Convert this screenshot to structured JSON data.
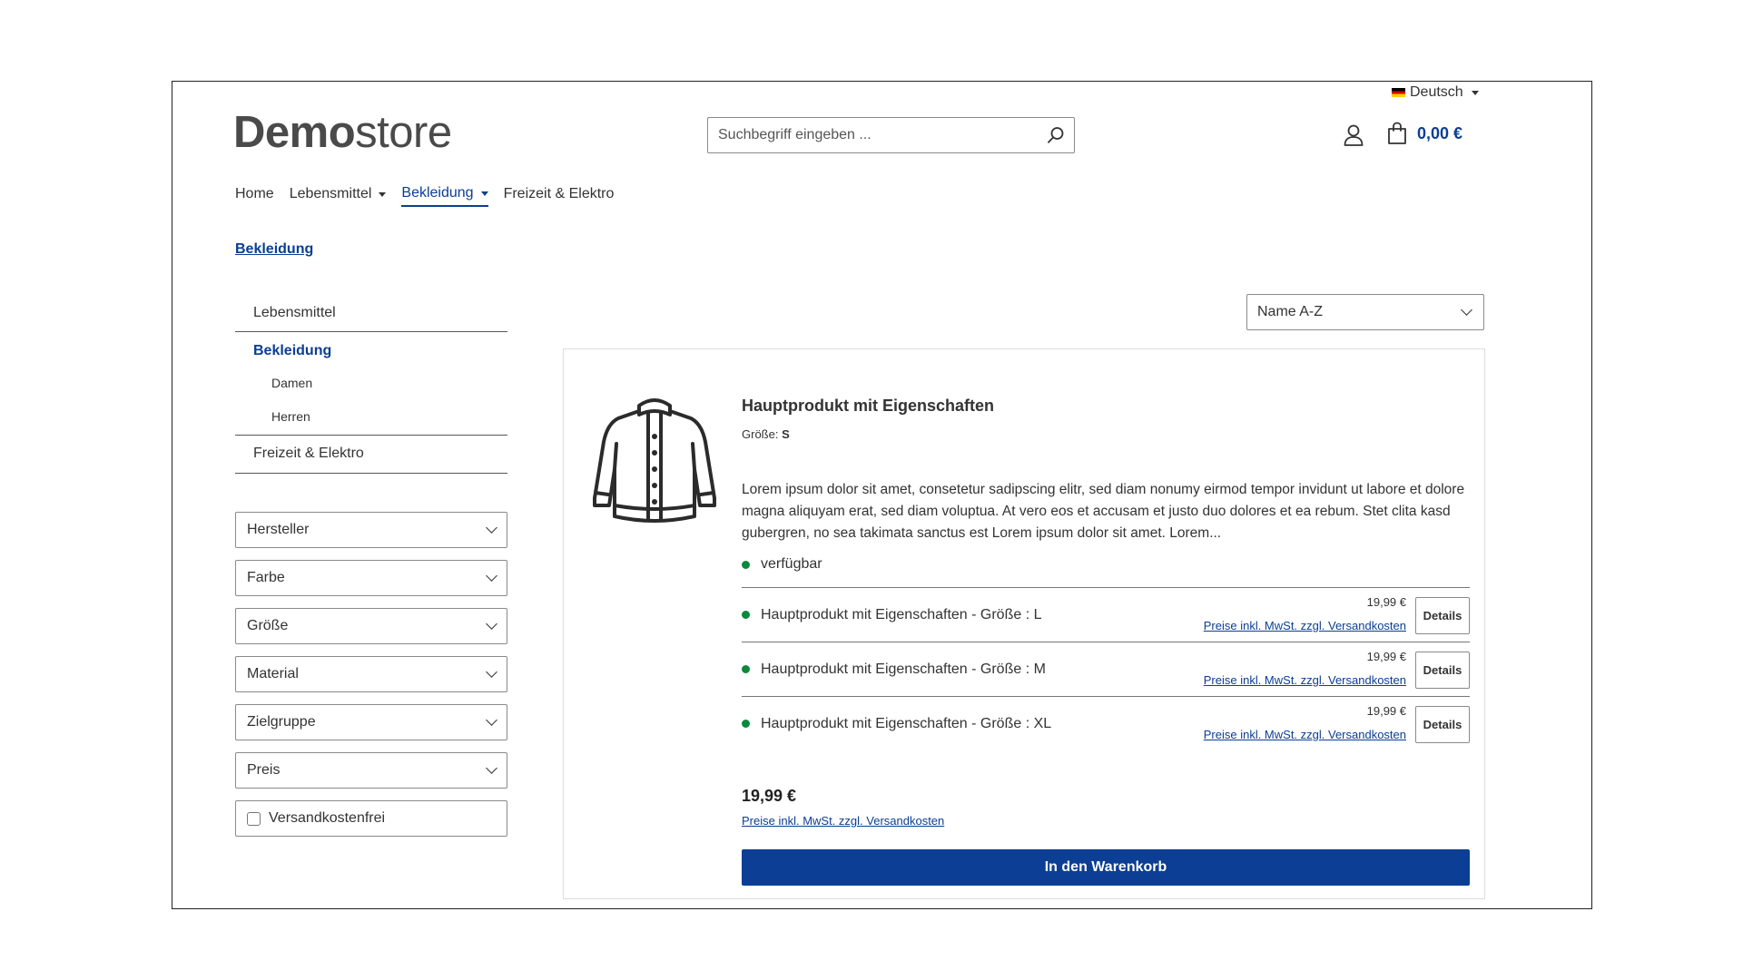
{
  "header": {
    "language": "Deutsch",
    "logo_bold": "Demo",
    "logo_light": "store",
    "search_placeholder": "Suchbegriff eingeben ...",
    "cart_total": "0,00 €"
  },
  "nav": {
    "items": [
      {
        "label": "Home",
        "dropdown": false,
        "active": false
      },
      {
        "label": "Lebensmittel",
        "dropdown": true,
        "active": false
      },
      {
        "label": "Bekleidung",
        "dropdown": true,
        "active": true
      },
      {
        "label": "Freizeit & Elektro",
        "dropdown": false,
        "active": false
      }
    ]
  },
  "page_title": "Bekleidung",
  "sidebar": {
    "categories": [
      {
        "label": "Lebensmittel"
      },
      {
        "label": "Bekleidung"
      },
      {
        "label": "Damen"
      },
      {
        "label": "Herren"
      },
      {
        "label": "Freizeit & Elektro"
      }
    ],
    "filters": [
      "Hersteller",
      "Farbe",
      "Größe",
      "Material",
      "Zielgruppe",
      "Preis"
    ],
    "shipping_free": "Versandkostenfrei"
  },
  "sort": {
    "selected": "Name A-Z"
  },
  "product": {
    "name": "Hauptprodukt mit Eigenschaften",
    "size_label": "Größe:",
    "size_value": "S",
    "description": "Lorem ipsum dolor sit amet, consetetur sadipscing elitr, sed diam nonumy eirmod tempor invidunt ut labore et dolore magna aliquyam erat, sed diam voluptua. At vero eos et accusam et justo duo dolores et ea rebum. Stet clita kasd gubergren, no sea takimata sanctus est Lorem ipsum dolor sit amet. Lorem...",
    "availability": "verfügbar",
    "variants": [
      {
        "name": "Hauptprodukt mit Eigenschaften - Größe : L",
        "price": "19,99 €",
        "price_note": "Preise inkl. MwSt. zzgl. Versandkosten",
        "button": "Details"
      },
      {
        "name": "Hauptprodukt mit Eigenschaften - Größe : M",
        "price": "19,99 €",
        "price_note": "Preise inkl. MwSt. zzgl. Versandkosten",
        "button": "Details"
      },
      {
        "name": "Hauptprodukt mit Eigenschaften - Größe : XL",
        "price": "19,99 €",
        "price_note": "Preise inkl. MwSt. zzgl. Versandkosten",
        "button": "Details"
      }
    ],
    "price": "19,99 €",
    "price_note": "Preise inkl. MwSt. zzgl. Versandkosten",
    "add_to_cart": "In den Warenkorb",
    "image_icon": "jacket-icon"
  },
  "colors": {
    "accent": "#0b3e94",
    "available": "#0a8a3c"
  }
}
